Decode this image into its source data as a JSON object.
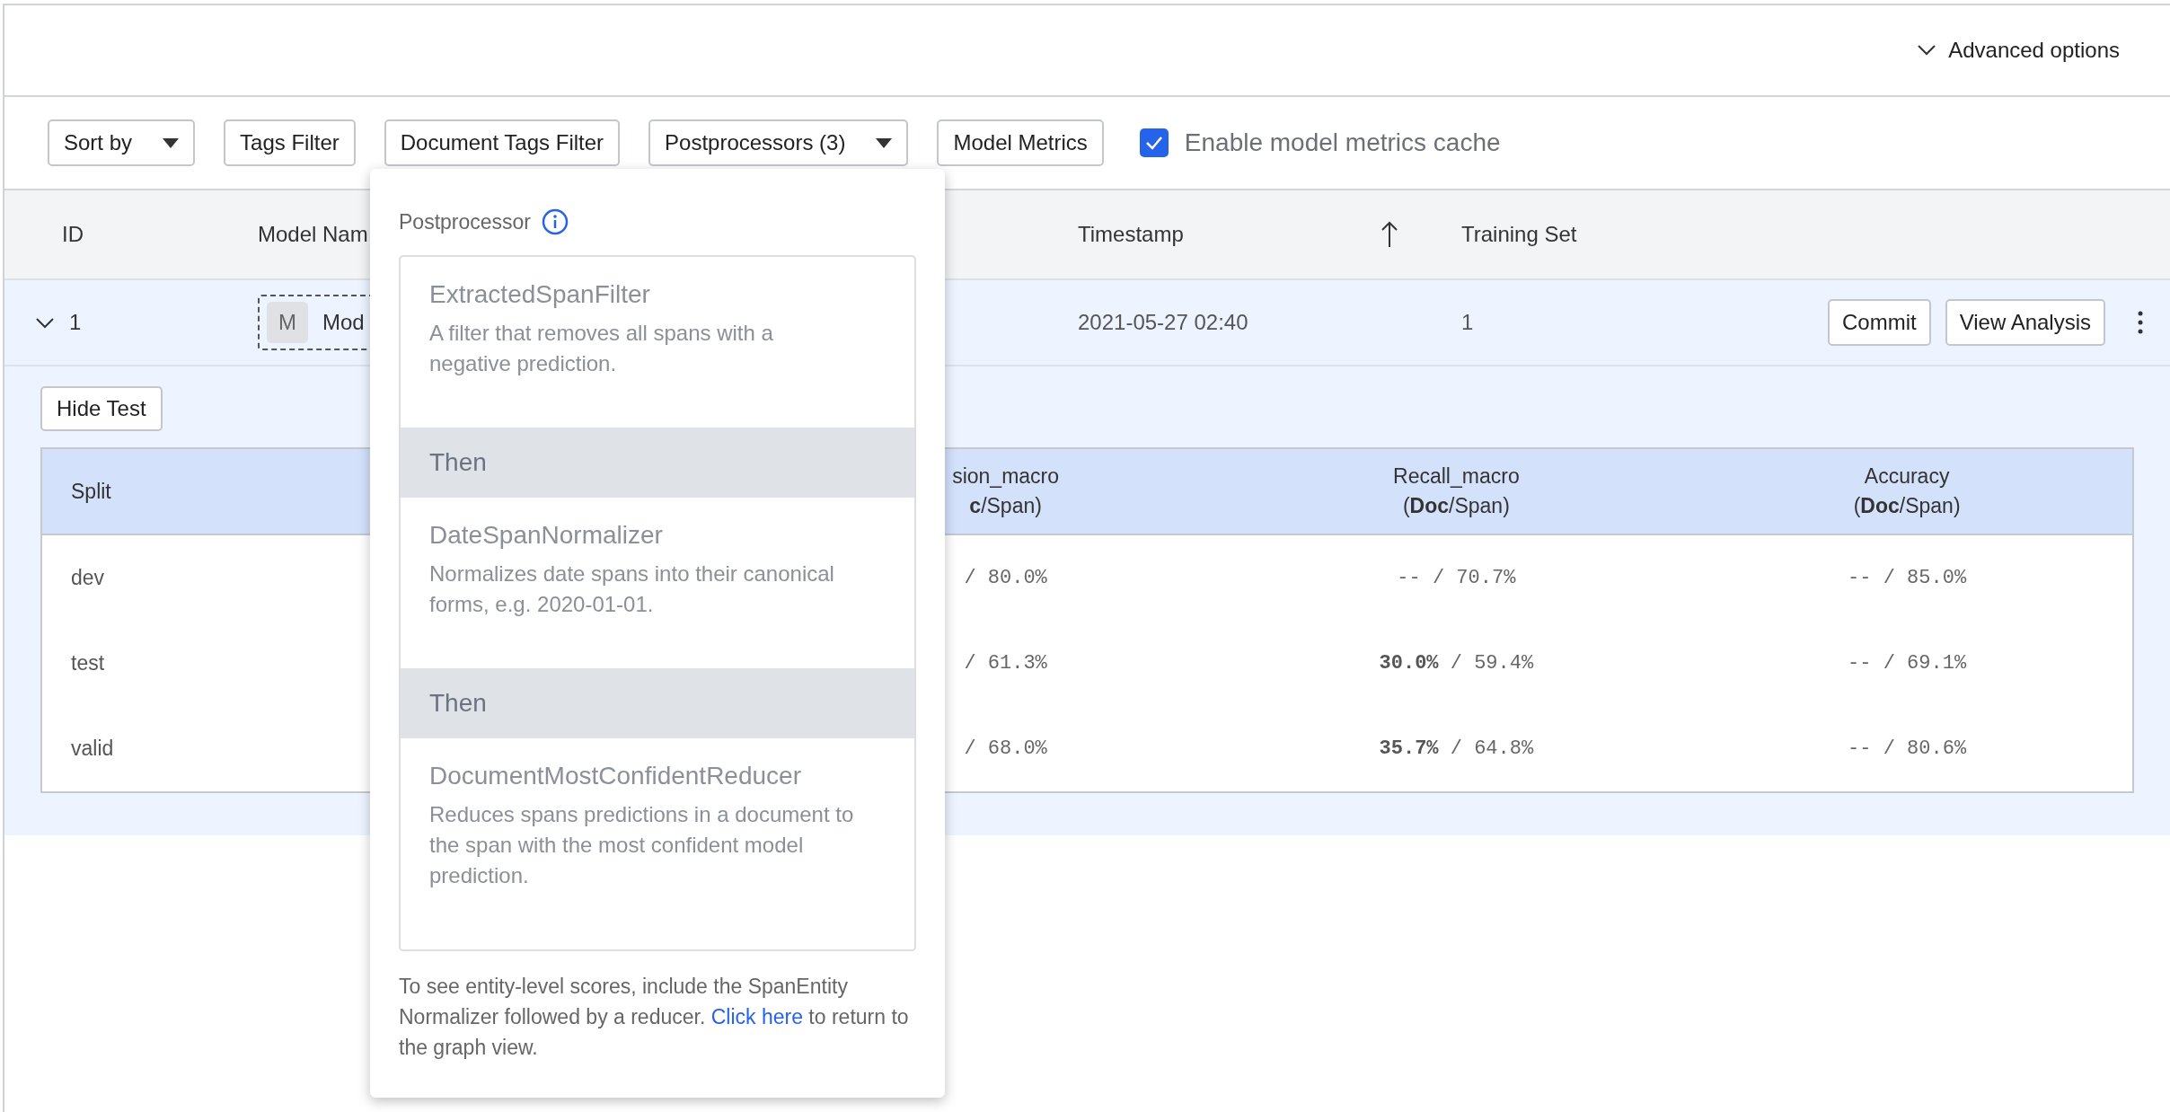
{
  "header": {
    "advanced_options": "Advanced options"
  },
  "toolbar": {
    "buttons": [
      {
        "label": "Sort by",
        "kind": "dropdown"
      },
      {
        "label": "Tags Filter",
        "kind": "plain"
      },
      {
        "label": "Document Tags Filter",
        "kind": "plain"
      },
      {
        "label": "Postprocessors (3)",
        "kind": "dropdown"
      },
      {
        "label": "Model Metrics",
        "kind": "plain"
      }
    ],
    "cache_checkbox": {
      "label": "Enable model metrics cache",
      "checked": true
    }
  },
  "table": {
    "columns": [
      "ID",
      "Model Nam",
      "Timestamp",
      "Training Set"
    ],
    "rows": [
      {
        "expanded": true,
        "id": "1",
        "model_avatar": "M",
        "model_name": "Mod",
        "timestamp": "2021-05-27 02:40",
        "training_set": "1",
        "actions": [
          "Commit",
          "View Analysis"
        ]
      }
    ]
  },
  "details": {
    "hide_test_button": "Hide Test",
    "columns": [
      {
        "label": "Split"
      },
      {
        "label": "sion_macro",
        "sub": "**c**/Span)"
      },
      {
        "label": "Recall_macro",
        "sub": "(**Doc**/Span)"
      },
      {
        "label": "Accuracy",
        "sub": "(**Doc**/Span)"
      }
    ],
    "rows": [
      [
        "dev",
        "/ 80.0%",
        "-- / 70.7%",
        "-- / 85.0%"
      ],
      [
        "test",
        "/ 61.3%",
        "**30.0%** / 59.4%",
        "-- / 69.1%"
      ],
      [
        "valid",
        "/ 68.0%",
        "**35.7%** / 64.8%",
        "-- / 80.6%"
      ]
    ]
  },
  "popup": {
    "title": "Postprocessor",
    "items": [
      {
        "kind": "step",
        "name": "ExtractedSpanFilter",
        "description": "A filter that removes all spans with a negative prediction."
      },
      {
        "kind": "separator",
        "label": "Then"
      },
      {
        "kind": "step",
        "name": "DateSpanNormalizer",
        "description": "Normalizes date spans into their canonical forms, e.g. 2020-01-01."
      },
      {
        "kind": "separator",
        "label": "Then"
      },
      {
        "kind": "step",
        "name": "DocumentMostConfidentReducer",
        "description": "Reduces spans predictions in a document to the span with the most confident model prediction."
      }
    ],
    "footer": {
      "before": "To see entity-level scores, include the SpanEntity Normalizer followed by a reducer. ",
      "link": "Click here",
      "after": " to return to the graph view."
    }
  }
}
